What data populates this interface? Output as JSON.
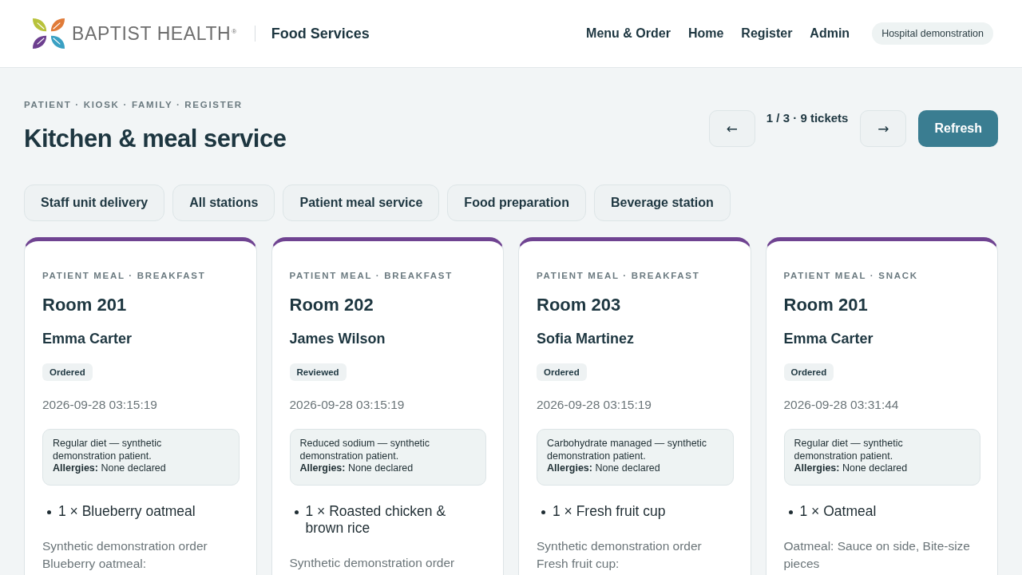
{
  "header": {
    "brand": "BAPTIST HEALTH$^{®}$",
    "app_title": "Food Services",
    "nav": [
      "Menu & Order",
      "Home",
      "Register",
      "Admin"
    ],
    "badge": "Hospital demonstration"
  },
  "page": {
    "eyebrow": "PATIENT · KIOSK · FAMILY · REGISTER",
    "title": "Kitchen & meal service",
    "pager": {
      "previous": "←",
      "status": "1 / 3 · 9 tickets",
      "next": "→"
    },
    "refresh": "Refresh"
  },
  "filters": [
    {
      "label": "Staff unit delivery",
      "selected": false
    },
    {
      "label": "All stations",
      "selected": false
    },
    {
      "label": "Patient meal service",
      "selected": false
    },
    {
      "label": "Food preparation",
      "selected": false
    },
    {
      "label": "Beverage station",
      "selected": false
    }
  ],
  "tickets": [
    {
      "category": "PATIENT MEAL · BREAKFAST",
      "room": "Room 201",
      "patient": "Emma Carter",
      "status": "Ordered",
      "time": "2026-09-28 03:15:19",
      "diet": "Regular diet — synthetic demonstration patient.",
      "allergies": "**Allergies:** None declared",
      "items": [
        "1 × Blueberry oatmeal"
      ],
      "notes": [
        "Synthetic demonstration order",
        "Blueberry oatmeal:"
      ]
    },
    {
      "category": "PATIENT MEAL · BREAKFAST",
      "room": "Room 202",
      "patient": "James Wilson",
      "status": "Reviewed",
      "time": "2026-09-28 03:15:19",
      "diet": "Reduced sodium — synthetic demonstration patient.",
      "allergies": "**Allergies:** None declared",
      "items": [
        "1 × Roasted chicken & brown rice"
      ],
      "notes": [
        "Synthetic demonstration order"
      ]
    },
    {
      "category": "PATIENT MEAL · BREAKFAST",
      "room": "Room 203",
      "patient": "Sofia Martinez",
      "status": "Ordered",
      "time": "2026-09-28 03:15:19",
      "diet": "Carbohydrate managed — synthetic demonstration patient.",
      "allergies": "**Allergies:** None declared",
      "items": [
        "1 × Fresh fruit cup"
      ],
      "notes": [
        "Synthetic demonstration order",
        "Fresh fruit cup:"
      ]
    },
    {
      "category": "PATIENT MEAL · SNACK",
      "room": "Room 201",
      "patient": "Emma Carter",
      "status": "Ordered",
      "time": "2026-09-28 03:31:44",
      "diet": "Regular diet — synthetic demonstration patient.",
      "allergies": "**Allergies:** None declared",
      "items": [
        "1 × Oatmeal"
      ],
      "notes": [
        "Oatmeal: Sauce on side, Bite-size pieces"
      ]
    }
  ]
}
